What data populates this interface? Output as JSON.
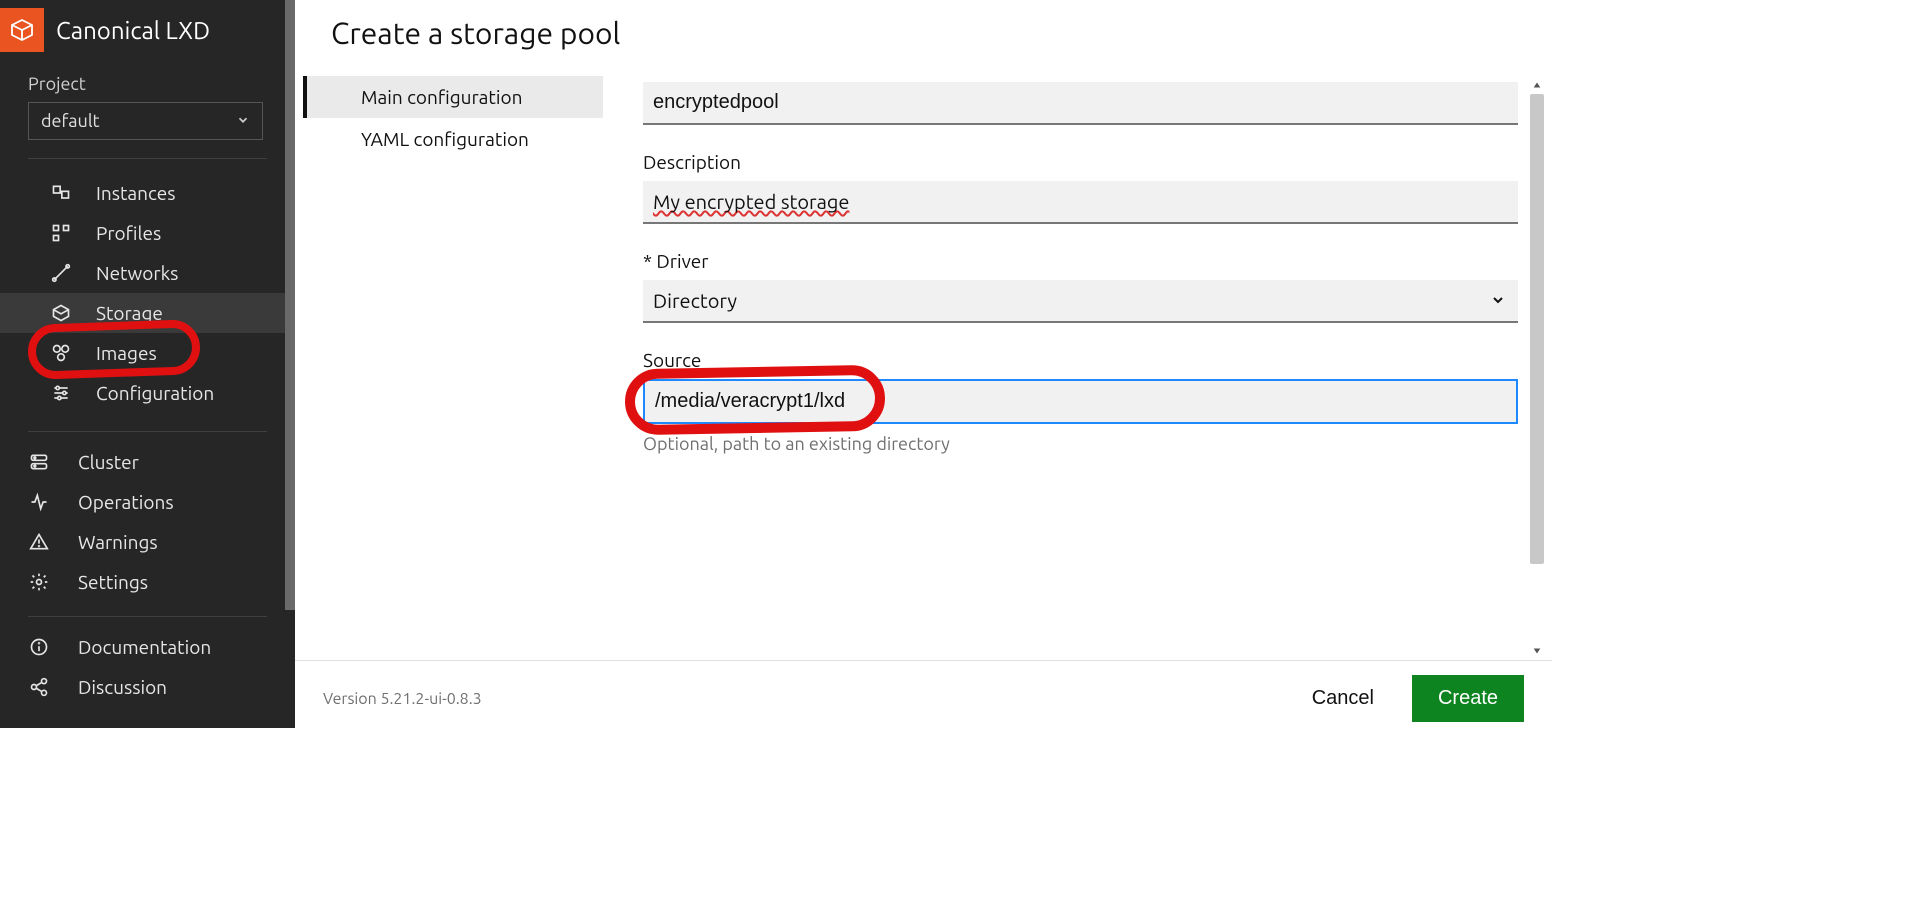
{
  "brand": {
    "name": "Canonical LXD"
  },
  "project": {
    "label": "Project",
    "selected": "default"
  },
  "sidebar": {
    "items": [
      {
        "label": "Instances",
        "icon": "instances-icon"
      },
      {
        "label": "Profiles",
        "icon": "profiles-icon"
      },
      {
        "label": "Networks",
        "icon": "networks-icon"
      },
      {
        "label": "Storage",
        "icon": "storage-icon",
        "active": true
      },
      {
        "label": "Images",
        "icon": "images-icon"
      },
      {
        "label": "Configuration",
        "icon": "configuration-icon"
      }
    ],
    "bottom": [
      {
        "label": "Cluster",
        "icon": "cluster-icon"
      },
      {
        "label": "Operations",
        "icon": "operations-icon"
      },
      {
        "label": "Warnings",
        "icon": "warnings-icon"
      },
      {
        "label": "Settings",
        "icon": "settings-icon"
      }
    ],
    "footer": [
      {
        "label": "Documentation",
        "icon": "info-icon"
      },
      {
        "label": "Discussion",
        "icon": "share-icon"
      }
    ]
  },
  "page": {
    "title": "Create a storage pool"
  },
  "subnav": {
    "items": [
      {
        "label": "Main configuration",
        "selected": true
      },
      {
        "label": "YAML configuration"
      }
    ]
  },
  "form": {
    "name": {
      "value": "encryptedpool"
    },
    "description": {
      "label": "Description",
      "value": "My encrypted storage"
    },
    "driver": {
      "label": "* Driver",
      "value": "Directory"
    },
    "source": {
      "label": "Source",
      "value": "/media/veracrypt1/lxd",
      "help": "Optional, path to an existing directory"
    }
  },
  "footer": {
    "version": "Version 5.21.2-ui-0.8.3",
    "cancel_label": "Cancel",
    "create_label": "Create"
  }
}
